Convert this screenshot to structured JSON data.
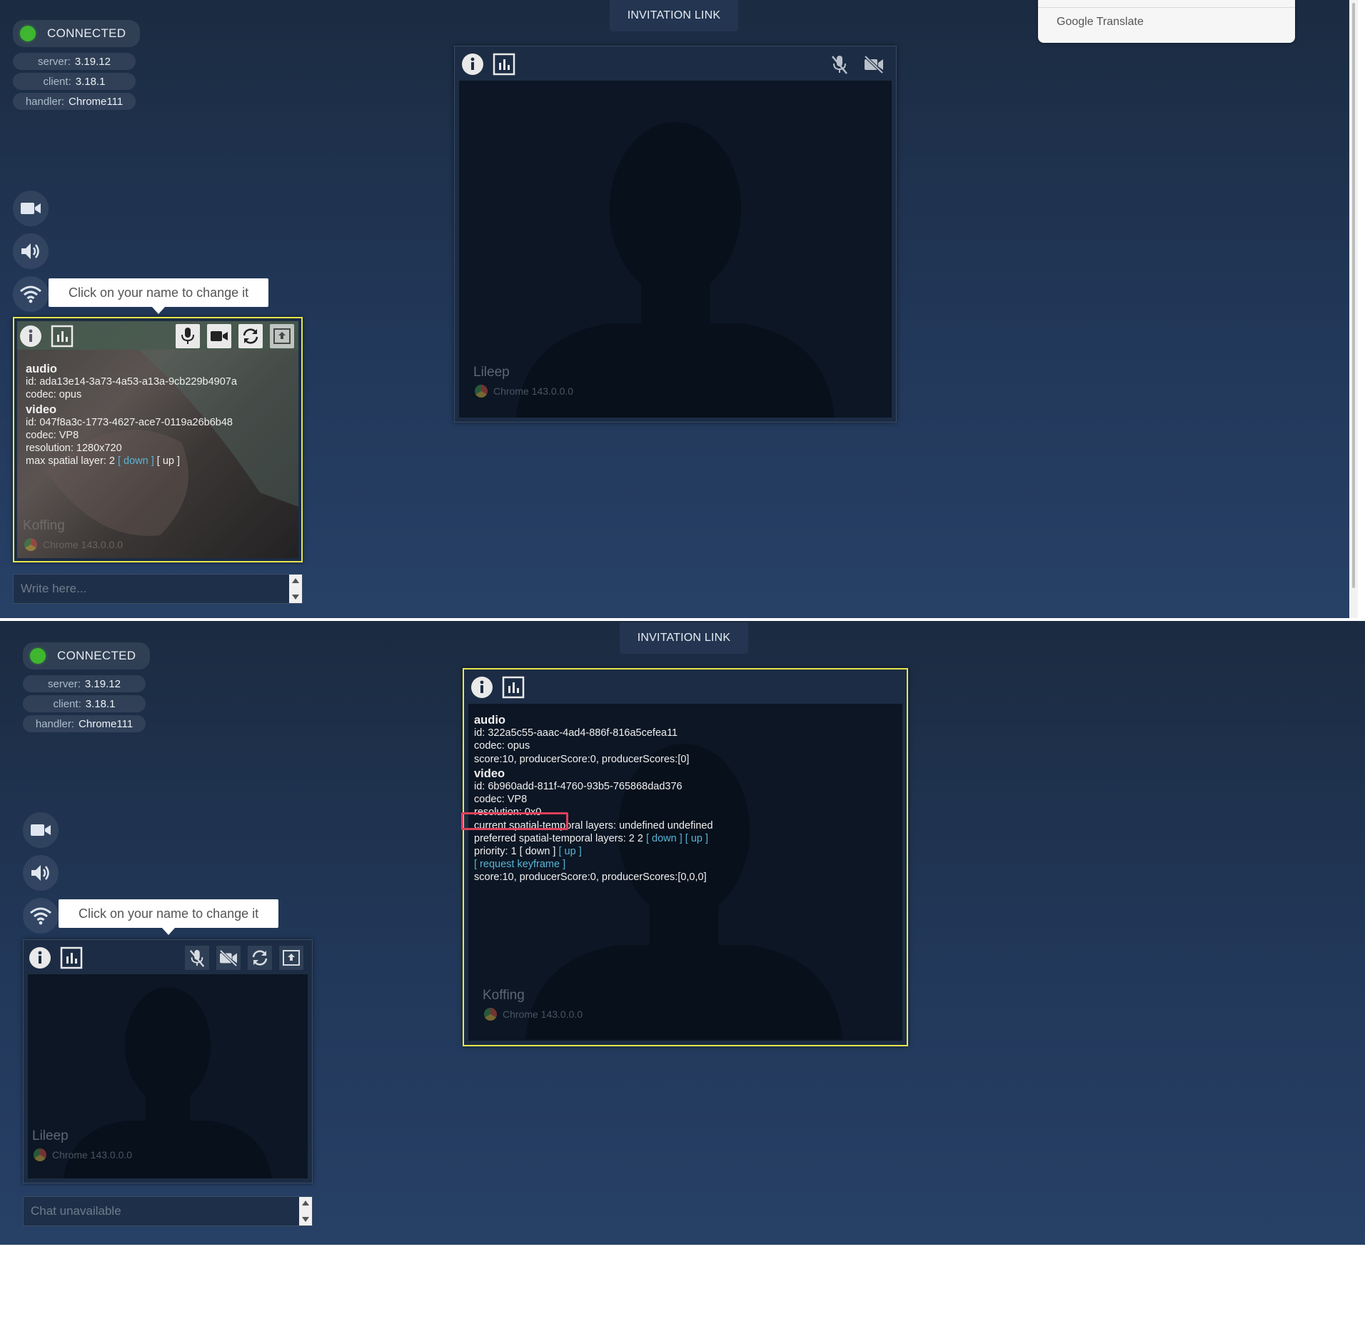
{
  "top": {
    "status": {
      "label": "CONNECTED",
      "color": "#3fb62f"
    },
    "info": [
      {
        "key": "server:",
        "value": "3.19.12"
      },
      {
        "key": "client:",
        "value": "3.18.1"
      },
      {
        "key": "handler:",
        "value": "Chrome111"
      }
    ],
    "invitation": "INVITATION LINK",
    "google_translate": {
      "brand": "Google",
      "word": "Translate"
    },
    "tooltip": "Click on your name to change it",
    "remote_peer": {
      "name": "Lileep",
      "browser": "Chrome 143.0.0.0"
    },
    "me": {
      "name": "Koffing",
      "browser": "Chrome 143.0.0.0",
      "audio": {
        "heading": "audio",
        "id": "id: ada13e14-3a73-4a53-a13a-9cb229b4907a",
        "codec": "codec: opus"
      },
      "video": {
        "heading": "video",
        "id": "id: 047f8a3c-1773-4627-ace7-0119a26b6b48",
        "codec": "codec: VP8",
        "resolution": "resolution: 1280x720",
        "layer_label": "max spatial layer: 2",
        "down": "[ down ]",
        "up": "[ up ]"
      }
    },
    "chat_placeholder": "Write here..."
  },
  "bottom": {
    "status": {
      "label": "CONNECTED",
      "color": "#3fb62f"
    },
    "info": [
      {
        "key": "server:",
        "value": "3.19.12"
      },
      {
        "key": "client:",
        "value": "3.18.1"
      },
      {
        "key": "handler:",
        "value": "Chrome111"
      }
    ],
    "invitation": "INVITATION LINK",
    "tooltip": "Click on your name to change it",
    "remote_peer": {
      "name": "Koffing",
      "browser": "Chrome 143.0.0.0",
      "audio": {
        "heading": "audio",
        "id": "id: 322a5c55-aaac-4ad4-886f-816a5cefea11",
        "codec": "codec: opus",
        "score": "score:10, producerScore:0, producerScores:[0]"
      },
      "video": {
        "heading": "video",
        "id": "id: 6b960add-811f-4760-93b5-765868dad376",
        "codec": "codec: VP8",
        "resolution": "resolution: 0x0",
        "current_layers": "current spatial-temporal layers: undefined undefined",
        "preferred_label": "preferred spatial-temporal layers: 2 2",
        "preferred_down": "[ down ]",
        "preferred_up": "[ up ]",
        "priority_label": "priority: 1",
        "priority_down": "[ down ]",
        "priority_up": "[ up ]",
        "keyframe": "[ request keyframe ]",
        "score": "score:10, producerScore:0, producerScores:[0,0,0]"
      }
    },
    "me": {
      "name": "Lileep",
      "browser": "Chrome 143.0.0.0"
    },
    "chat_placeholder": "Chat unavailable"
  },
  "colors": {
    "active_border": "#e6e84a",
    "highlight": "#e0405a",
    "link": "#58b4d6"
  }
}
